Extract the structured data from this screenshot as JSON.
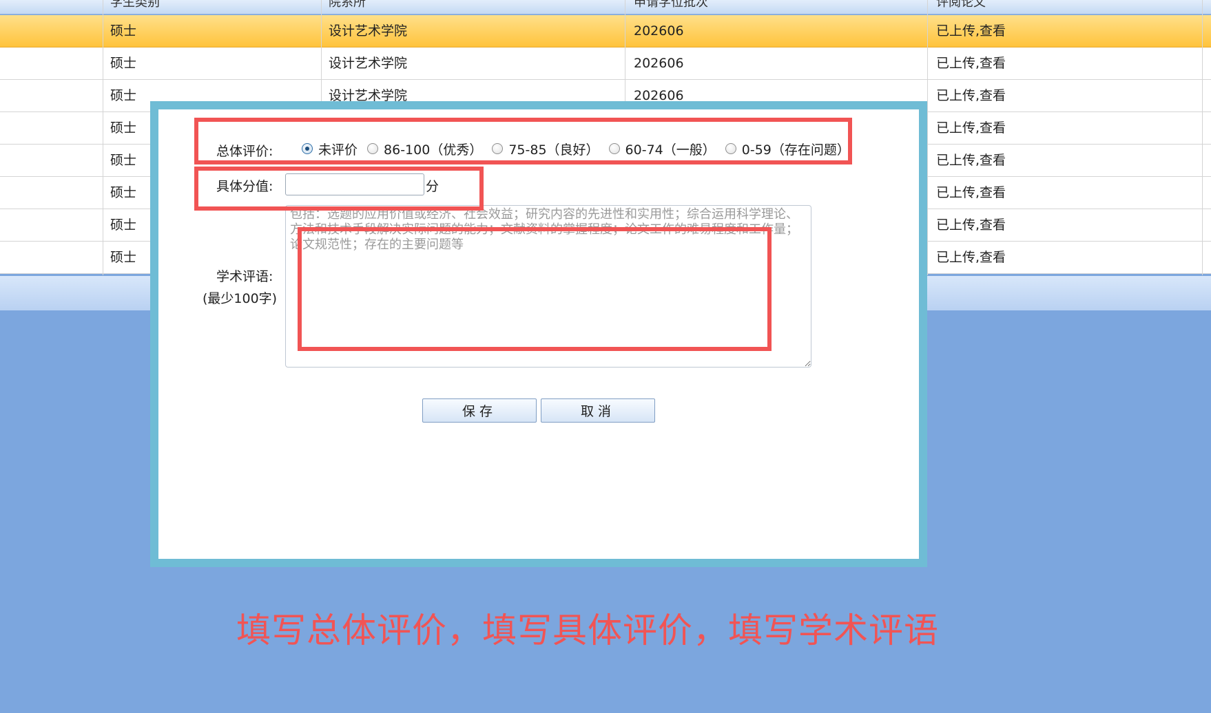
{
  "table": {
    "headers": [
      "学生类别",
      "院系所",
      "申请学位批次",
      "评阅论文"
    ],
    "rows": [
      {
        "type": "硕士",
        "dept": "设计艺术学院",
        "batch": "202606",
        "status": "已上传,",
        "link": "查看"
      },
      {
        "type": "硕士",
        "dept": "设计艺术学院",
        "batch": "202606",
        "status": "已上传,",
        "link": "查看"
      },
      {
        "type": "硕士",
        "dept": "设计艺术学院",
        "batch": "202606",
        "status": "已上传,",
        "link": "查看"
      },
      {
        "type": "硕士",
        "dept": "",
        "batch": "",
        "status": "已上传,",
        "link": "查看"
      },
      {
        "type": "硕士",
        "dept": "",
        "batch": "",
        "status": "已上传,",
        "link": "查看"
      },
      {
        "type": "硕士",
        "dept": "",
        "batch": "",
        "status": "已上传,",
        "link": "查看"
      },
      {
        "type": "硕士",
        "dept": "",
        "batch": "",
        "status": "已上传,",
        "link": "查看"
      },
      {
        "type": "硕士",
        "dept": "",
        "batch": "",
        "status": "已上传,",
        "link": "查看"
      }
    ]
  },
  "dialog": {
    "overall_label": "总体评价:",
    "overall_options": [
      "未评价",
      "86-100（优秀）",
      "75-85（良好）",
      "60-74（一般）",
      "0-59（存在问题）"
    ],
    "overall_selected": "未评价",
    "score_label": "具体分值:",
    "score_value": "",
    "score_unit": "分",
    "comment_label": "学术评语:",
    "comment_hint": "(最少100字)",
    "comment_placeholder": "包括：选题的应用价值或经济、社会效益；研究内容的先进性和实用性；综合运用科学理论、方法和技术手段解决实际问题的能力；文献资料的掌握程度；论文工作的难易程度和工作量；论文规范性；存在的主要问题等",
    "save_label": "保存",
    "cancel_label": "取消"
  },
  "annotation": {
    "caption": "填写总体评价，填写具体评价，填写学术评语",
    "color": "#f15454"
  },
  "colors": {
    "page_bg": "#7ca6de",
    "dialog_frame": "#6fbcd5",
    "row_highlight": "#ffc33c"
  }
}
